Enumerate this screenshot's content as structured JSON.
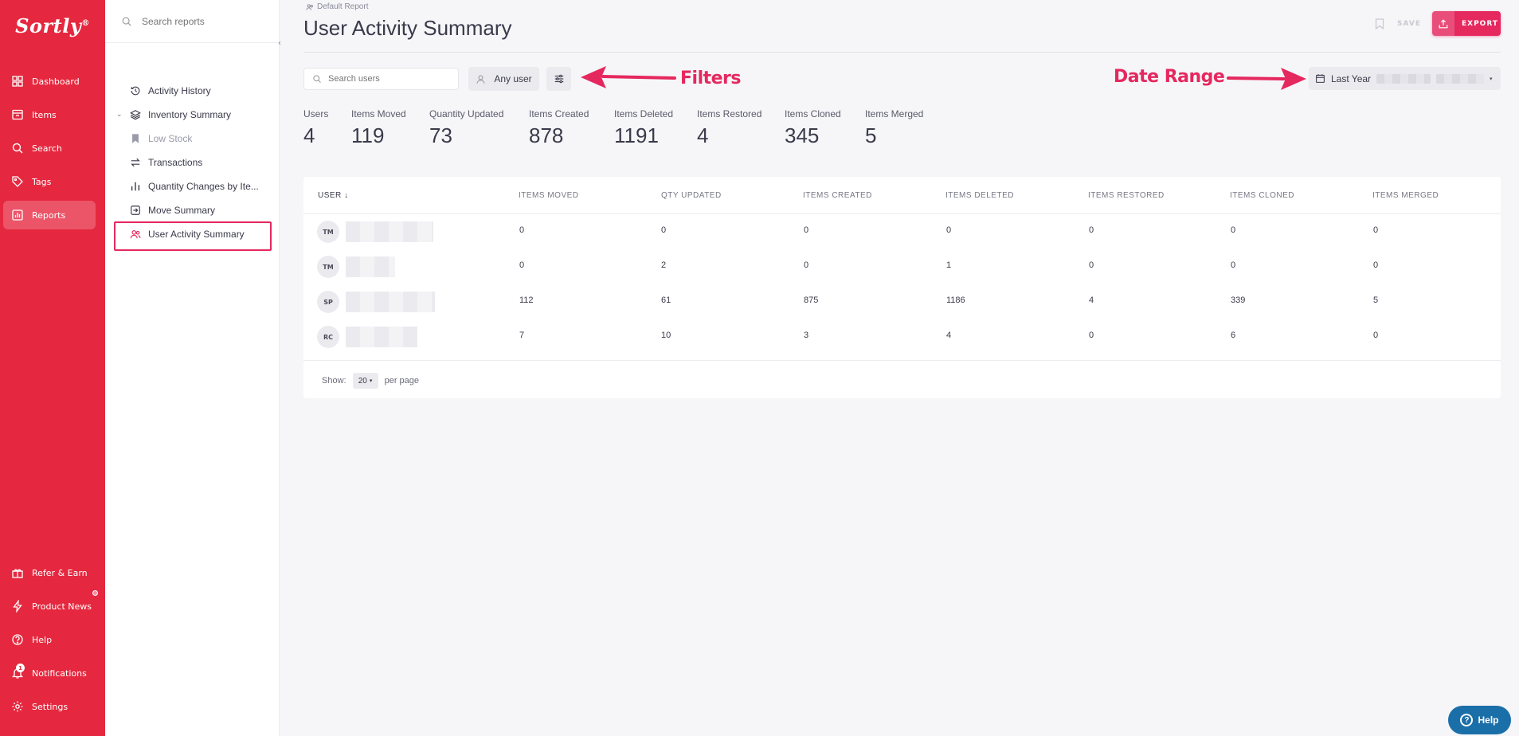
{
  "brand": {
    "logo_text": "Sortly",
    "logo_mark": "®",
    "color": "#e5283f",
    "accent": "#e5285e"
  },
  "nav": {
    "top": [
      {
        "label": "Dashboard",
        "icon": "dashboard-icon"
      },
      {
        "label": "Items",
        "icon": "items-icon"
      },
      {
        "label": "Search",
        "icon": "search-icon"
      },
      {
        "label": "Tags",
        "icon": "tag-icon"
      },
      {
        "label": "Reports",
        "icon": "reports-icon",
        "active": true
      }
    ],
    "bottom": [
      {
        "label": "Refer & Earn",
        "icon": "gift-icon"
      },
      {
        "label": "Product News",
        "icon": "lightning-icon"
      },
      {
        "label": "Help",
        "icon": "help-icon"
      },
      {
        "label": "Notifications",
        "icon": "bell-icon",
        "badge": "1"
      },
      {
        "label": "Settings",
        "icon": "gear-icon"
      }
    ]
  },
  "sidebar": {
    "search_placeholder": "Search reports",
    "items": [
      {
        "label": "Activity History",
        "icon": "history-icon"
      },
      {
        "label": "Inventory Summary",
        "icon": "layers-icon"
      },
      {
        "label": "Low Stock",
        "icon": "bookmark-icon"
      },
      {
        "label": "Transactions",
        "icon": "transfer-icon"
      },
      {
        "label": "Quantity Changes by Ite...",
        "icon": "bar-chart-icon"
      },
      {
        "label": "Move Summary",
        "icon": "move-icon"
      },
      {
        "label": "User Activity Summary",
        "icon": "users-icon",
        "selected": true
      }
    ]
  },
  "header": {
    "breadcrumb": "Default Report",
    "title": "User Activity Summary",
    "save_label": "SAVE",
    "export_label": "EXPORT"
  },
  "filters": {
    "search_placeholder": "Search users",
    "user_filter": "Any user",
    "date_range": "Last Year"
  },
  "annotations": {
    "filters": "Filters",
    "date_range": "Date Range"
  },
  "stats": [
    {
      "label": "Users",
      "value": "4"
    },
    {
      "label": "Items Moved",
      "value": "119"
    },
    {
      "label": "Quantity Updated",
      "value": "73"
    },
    {
      "label": "Items Created",
      "value": "878"
    },
    {
      "label": "Items Deleted",
      "value": "1191"
    },
    {
      "label": "Items Restored",
      "value": "4"
    },
    {
      "label": "Items Cloned",
      "value": "345"
    },
    {
      "label": "Items Merged",
      "value": "5"
    }
  ],
  "table": {
    "columns": [
      "USER",
      "ITEMS MOVED",
      "QTY UPDATED",
      "ITEMS CREATED",
      "ITEMS DELETED",
      "ITEMS RESTORED",
      "ITEMS CLONED",
      "ITEMS MERGED"
    ],
    "rows": [
      {
        "initials": "TM",
        "cells": [
          "0",
          "0",
          "0",
          "0",
          "0",
          "0",
          "0"
        ]
      },
      {
        "initials": "TM",
        "cells": [
          "0",
          "2",
          "0",
          "1",
          "0",
          "0",
          "0"
        ]
      },
      {
        "initials": "SP",
        "cells": [
          "112",
          "61",
          "875",
          "1186",
          "4",
          "339",
          "5"
        ]
      },
      {
        "initials": "RC",
        "cells": [
          "7",
          "10",
          "3",
          "4",
          "0",
          "6",
          "0"
        ]
      }
    ],
    "show_label": "Show:",
    "per_page_value": "20",
    "per_page_label": "per page"
  },
  "help_widget": {
    "label": "Help"
  }
}
